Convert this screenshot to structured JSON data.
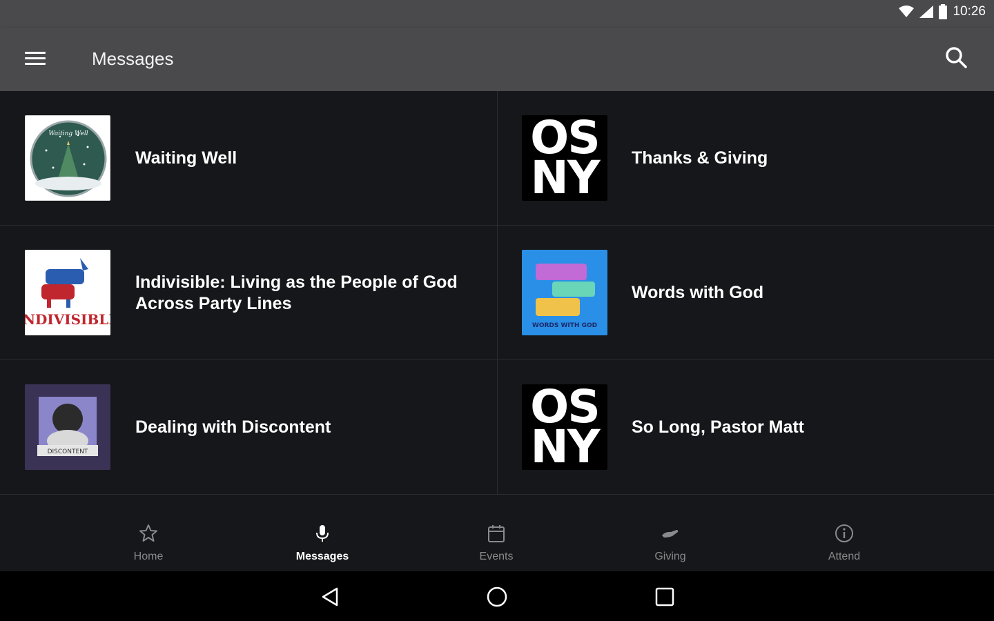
{
  "status": {
    "time": "10:26"
  },
  "appbar": {
    "title": "Messages"
  },
  "messages": [
    {
      "title": "Waiting Well",
      "thumb": "christmas-tree-globe",
      "logo_text": "Waiting Well"
    },
    {
      "title": "Thanks & Giving",
      "thumb": "osny-logo",
      "logo_text": "OS NY"
    },
    {
      "title": "Indivisible: Living as the People of God Across Party Lines",
      "thumb": "indivisible-donkey-elephant",
      "logo_text": "INDIVISIBLE"
    },
    {
      "title": "Words with God",
      "thumb": "words-with-god",
      "logo_text": "WORDS WITH GOD"
    },
    {
      "title": "Dealing with Discontent",
      "thumb": "discontent-illustration",
      "logo_text": "DISCONTENT"
    },
    {
      "title": "So Long, Pastor Matt",
      "thumb": "osny-logo",
      "logo_text": "OS NY"
    }
  ],
  "bottom_nav": [
    {
      "label": "Home",
      "icon": "star-icon",
      "active": false
    },
    {
      "label": "Messages",
      "icon": "microphone-icon",
      "active": true
    },
    {
      "label": "Events",
      "icon": "calendar-icon",
      "active": false
    },
    {
      "label": "Giving",
      "icon": "giving-hand-icon",
      "active": false
    },
    {
      "label": "Attend",
      "icon": "info-icon",
      "active": false
    }
  ],
  "colors": {
    "app_bar": "#4a4a4c",
    "background": "#16171a",
    "active_label": "#ffffff",
    "inactive_label": "#8a8a8c"
  }
}
